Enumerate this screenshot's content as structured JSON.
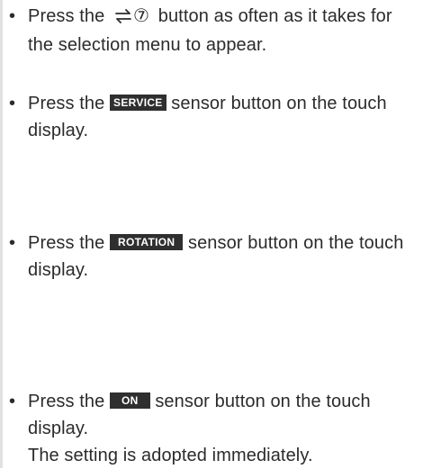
{
  "bullet": "•",
  "steps": [
    {
      "prefix": "Press the ",
      "icon": "swap-arrows-icon",
      "circled_number": "⑦",
      "suffix": " button as often as it takes for the selection menu to appear."
    },
    {
      "prefix": "Press the ",
      "badge": "SERVICE",
      "suffix": " sensor button on the touch display."
    },
    {
      "prefix": "Press the ",
      "badge": "ROTATION",
      "suffix": " sensor button on the touch display."
    },
    {
      "prefix": "Press the ",
      "badge": "ON",
      "suffix": " sensor button on the touch display.",
      "result": "The setting is adopted immediately."
    }
  ]
}
